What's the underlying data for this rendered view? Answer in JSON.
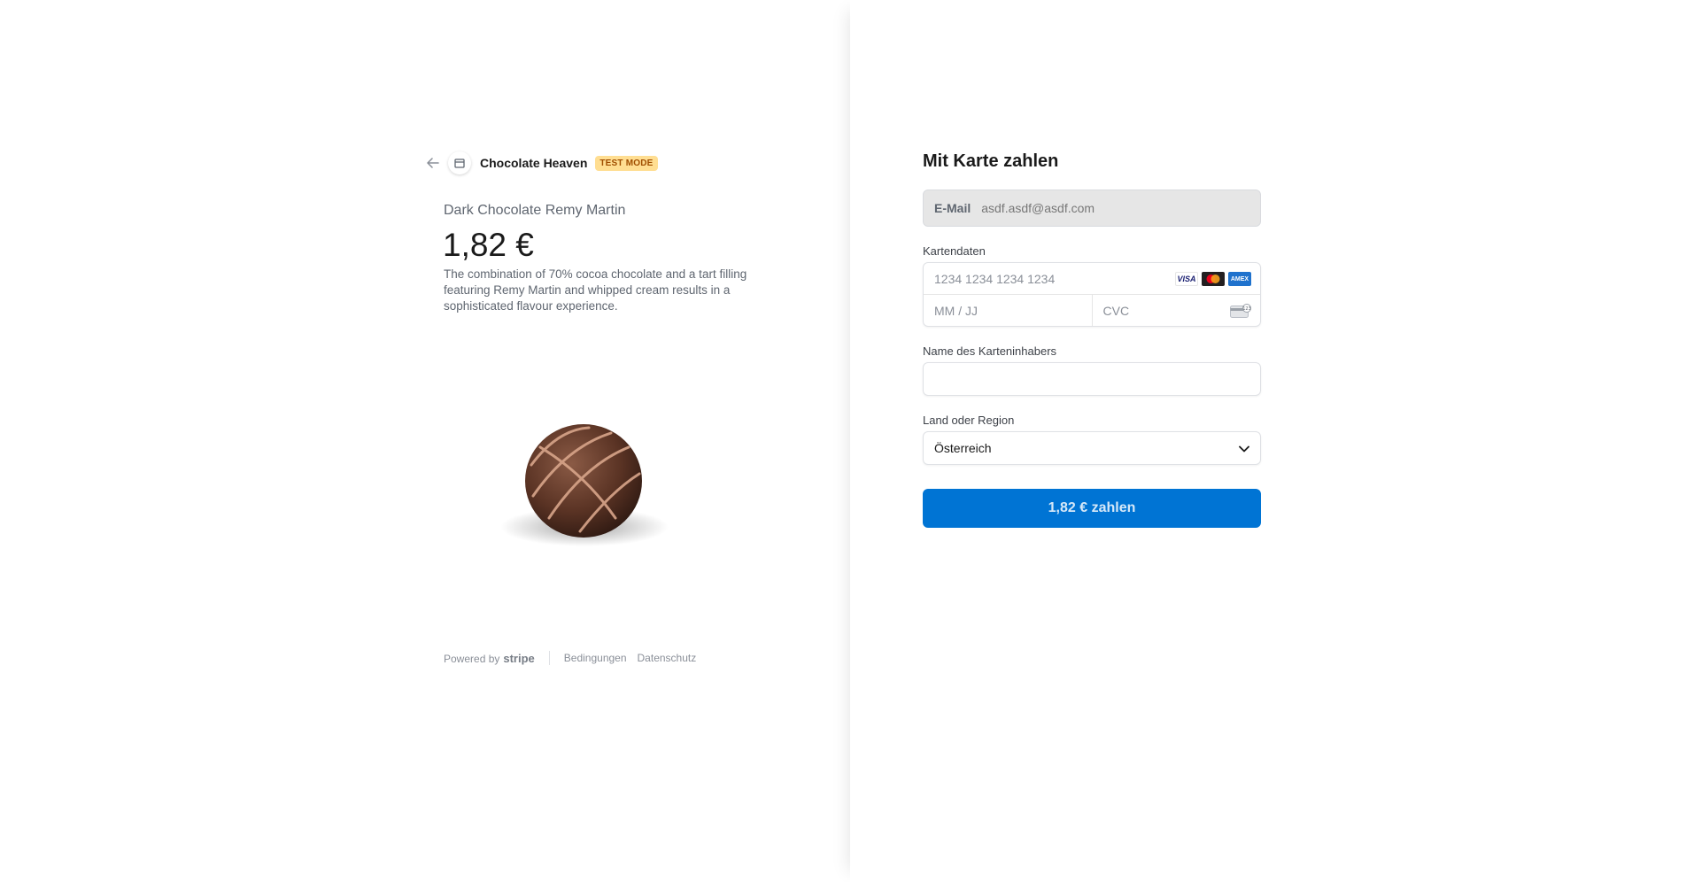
{
  "merchant": {
    "name": "Chocolate Heaven",
    "badge": "TEST MODE"
  },
  "product": {
    "name": "Dark Chocolate Remy Martin",
    "price": "1,82 €",
    "description": "The combination of 70% cocoa chocolate and a tart filling featuring Remy Martin and whipped cream results in a sophisticated flavour experience.",
    "image": "chocolate-truffle"
  },
  "footer": {
    "powered_by": "Powered by",
    "brand": "stripe",
    "terms": "Bedingungen",
    "privacy": "Datenschutz"
  },
  "form": {
    "title": "Mit Karte zahlen",
    "email": {
      "label": "E-Mail",
      "value": "asdf.asdf@asdf.com"
    },
    "card": {
      "label": "Kartendaten",
      "number_placeholder": "1234 1234 1234 1234",
      "expiry_placeholder": "MM / JJ",
      "cvc_placeholder": "CVC",
      "brands": [
        "visa",
        "mastercard",
        "amex"
      ],
      "visa_text": "VISA",
      "amex_text": "AMEX"
    },
    "cardholder": {
      "label": "Name des Karteninhabers",
      "value": ""
    },
    "country": {
      "label": "Land oder Region",
      "value": "Österreich"
    },
    "pay_button": "1,82 € zahlen"
  },
  "colors": {
    "accent": "#0074d4",
    "badge_bg": "#ffde92",
    "badge_text": "#a04e00"
  }
}
